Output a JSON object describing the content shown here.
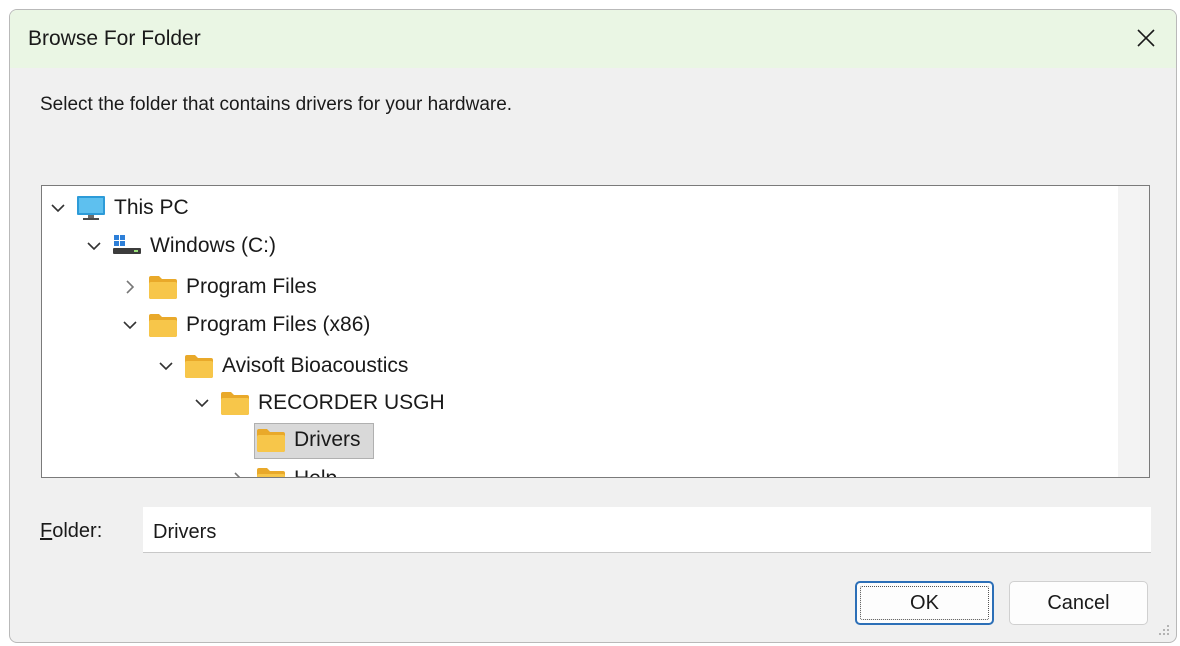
{
  "window": {
    "title": "Browse For Folder",
    "title_bar_color": "#eaf6e4"
  },
  "instruction": "Select the folder that contains drivers for your hardware.",
  "tree": {
    "nodes": [
      {
        "label": "This PC",
        "icon": "monitor-icon",
        "expanded": true,
        "level": 0
      },
      {
        "label": "Windows (C:)",
        "icon": "drive-icon",
        "expanded": true,
        "level": 1
      },
      {
        "label": "Program Files",
        "icon": "folder-icon",
        "expanded": false,
        "level": 2
      },
      {
        "label": "Program Files (x86)",
        "icon": "folder-icon",
        "expanded": true,
        "level": 2
      },
      {
        "label": "Avisoft Bioacoustics",
        "icon": "folder-icon",
        "expanded": true,
        "level": 3
      },
      {
        "label": "RECORDER USGH",
        "icon": "folder-icon",
        "expanded": true,
        "level": 4
      },
      {
        "label": "Drivers",
        "icon": "folder-icon",
        "selected": true,
        "level": 5
      },
      {
        "label": "Help",
        "icon": "folder-icon",
        "expanded": false,
        "level": 5
      }
    ]
  },
  "folder_field": {
    "label_prefix": "F",
    "label_rest": "older:",
    "value": "Drivers"
  },
  "buttons": {
    "ok": "OK",
    "cancel": "Cancel"
  },
  "colors": {
    "accent": "#2c6fb7",
    "folder": "#f7c64a",
    "monitor": "#2d9bd8"
  }
}
